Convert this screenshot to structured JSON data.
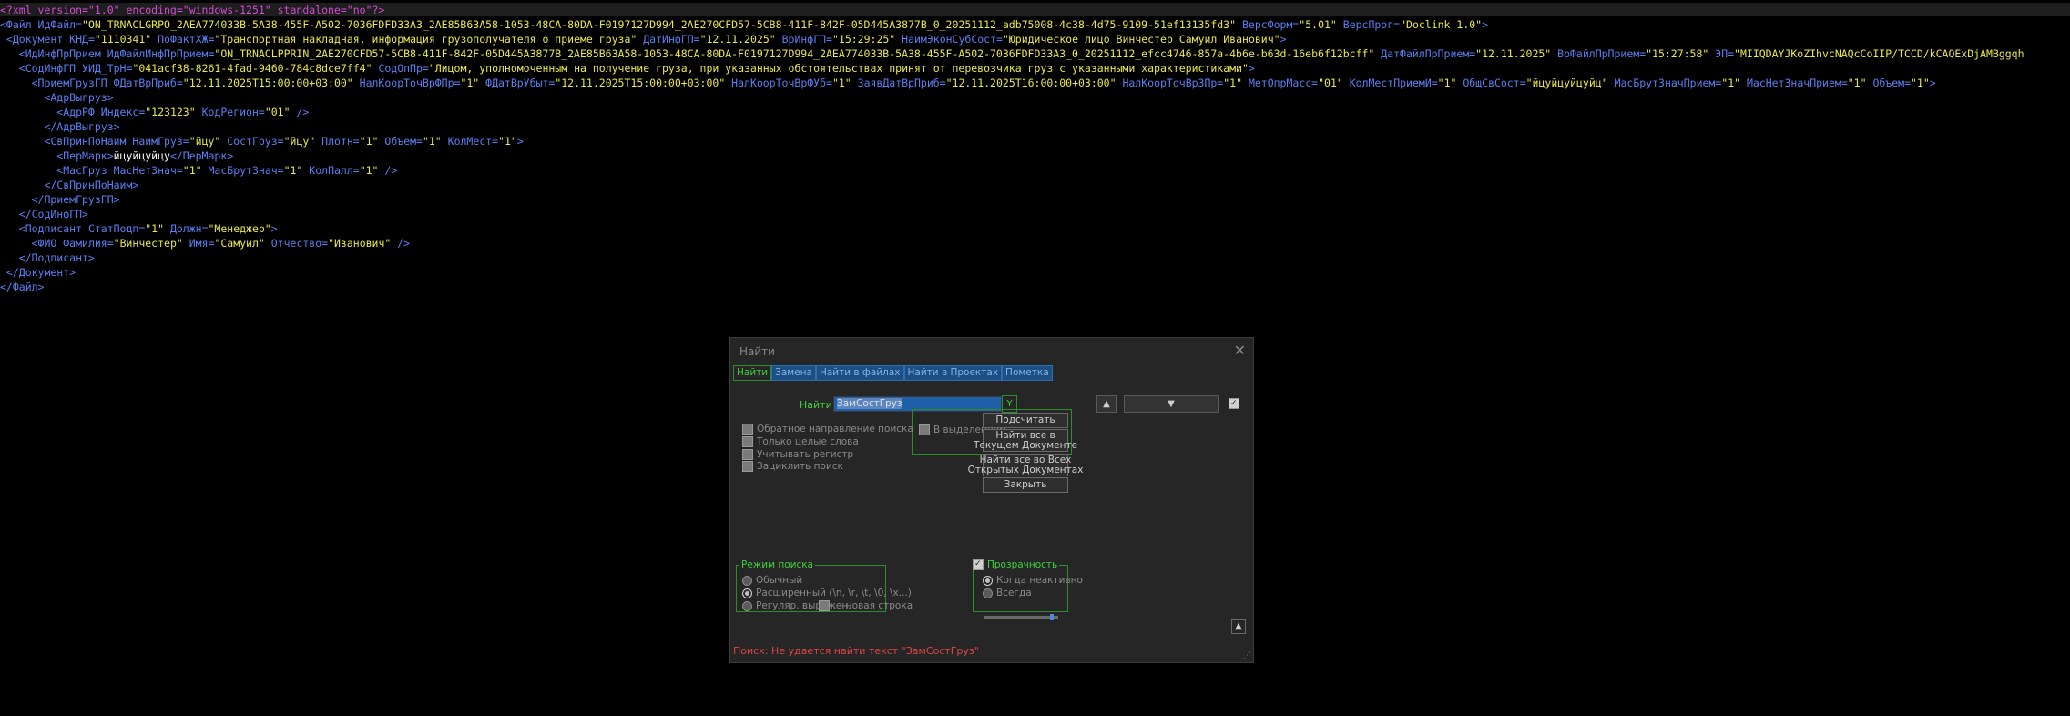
{
  "editor": {
    "lines": [
      [
        [
          "pi",
          "<?xml version=\"1.0\" encoding=\"windows-1251\" standalone=\"no\"?>"
        ]
      ],
      [
        [
          "tag",
          "<Файл "
        ],
        [
          "a",
          "ИдФайл="
        ],
        [
          "v",
          "\"ON_TRNACLGRPO_2AEA774033B-5A38-455F-A502-7036FDFD33A3_2AE85B63A58-1053-48CA-80DA-F0197127D994_2AE270CFD57-5CB8-411F-842F-05D445A3877B_0_20251112_adb75008-4c38-4d75-9109-51ef13135fd3\""
        ],
        [
          "a",
          " ВерсФорм="
        ],
        [
          "v",
          "\"5.01\""
        ],
        [
          "a",
          " ВерсПрог="
        ],
        [
          "v",
          "\"Doclink 1.0\""
        ],
        [
          "tag",
          ">"
        ]
      ],
      [
        [
          "tag",
          " <Документ "
        ],
        [
          "a",
          "КНД="
        ],
        [
          "v",
          "\"1110341\""
        ],
        [
          "a",
          " ПоФактХЖ="
        ],
        [
          "v",
          "\"Транспортная накладная, информация грузополучателя о приеме груза\""
        ],
        [
          "a",
          " ДатИнфГП="
        ],
        [
          "v",
          "\"12.11.2025\""
        ],
        [
          "a",
          " ВрИнфГП="
        ],
        [
          "v",
          "\"15:29:25\""
        ],
        [
          "a",
          " НаимЭконСубСост="
        ],
        [
          "v",
          "\"Юридическое лицо Винчестер Самуил Иванович\""
        ],
        [
          "tag",
          ">"
        ]
      ],
      [
        [
          "tag",
          "   <ИдИнфПрПрием "
        ],
        [
          "a",
          "ИдФайлИнфПрПрием="
        ],
        [
          "v",
          "\"ON_TRNACLPPRIN_2AE270CFD57-5CB8-411F-842F-05D445A3877B_2AE85B63A58-1053-48CA-80DA-F0197127D994_2AEA774033B-5A38-455F-A502-7036FDFD33A3_0_20251112_efcc4746-857a-4b6e-b63d-16eb6f12bcff\""
        ],
        [
          "a",
          " ДатФайлПрПрием="
        ],
        [
          "v",
          "\"12.11.2025\""
        ],
        [
          "a",
          " ВрФайлПрПрием="
        ],
        [
          "v",
          "\"15:27:58\""
        ],
        [
          "a",
          " ЭП="
        ],
        [
          "v",
          "\"MIIQDAYJKoZIhvcNAQcCoIIP/TCCD/kCAQExDjAMBggqh"
        ]
      ],
      [
        [
          "tag",
          "   <СодИнфГП "
        ],
        [
          "a",
          "УИД_ТрН="
        ],
        [
          "v",
          "\"041acf38-8261-4fad-9460-784c8dce7ff4\""
        ],
        [
          "a",
          " СодОпПр="
        ],
        [
          "v",
          "\"Лицом, уполномоченным на получение груза, при указанных обстоятельствах принят от перевозчика груз с указанными характеристиками\""
        ],
        [
          "tag",
          ">"
        ]
      ],
      [
        [
          "tag",
          "     <ПриемГрузГП "
        ],
        [
          "a",
          "ФДатВрПриб="
        ],
        [
          "v",
          "\"12.11.2025T15:00:00+03:00\""
        ],
        [
          "a",
          " НалКоорТочВрФПр="
        ],
        [
          "v",
          "\"1\""
        ],
        [
          "a",
          " ФДатВрУбыт="
        ],
        [
          "v",
          "\"12.11.2025T15:00:00+03:00\""
        ],
        [
          "a",
          " НалКоорТочВрФУб="
        ],
        [
          "v",
          "\"1\""
        ],
        [
          "a",
          " ЗаявДатВрПриб="
        ],
        [
          "v",
          "\"12.11.2025T16:00:00+03:00\""
        ],
        [
          "a",
          " НалКоорТочВрЗПр="
        ],
        [
          "v",
          "\"1\""
        ],
        [
          "a",
          " МетОпрМасс="
        ],
        [
          "v",
          "\"01\""
        ],
        [
          "a",
          " КолМестПриемИ="
        ],
        [
          "v",
          "\"1\""
        ],
        [
          "a",
          " ОбщСвСост="
        ],
        [
          "v",
          "\"йцуйцуйцуйц\""
        ],
        [
          "a",
          " МасБрутЗначПрием="
        ],
        [
          "v",
          "\"1\""
        ],
        [
          "a",
          " МасНетЗначПрием="
        ],
        [
          "v",
          "\"1\""
        ],
        [
          "a",
          " Объем="
        ],
        [
          "v",
          "\"1\""
        ],
        [
          "tag",
          ">"
        ]
      ],
      [
        [
          "tag",
          "       <АдрВыгруз>"
        ]
      ],
      [
        [
          "tag",
          "         <АдрРФ "
        ],
        [
          "a",
          "Индекс="
        ],
        [
          "v",
          "\"123123\""
        ],
        [
          "a",
          " КодРегион="
        ],
        [
          "v",
          "\"01\""
        ],
        [
          "tag",
          " />"
        ]
      ],
      [
        [
          "tag",
          "       </АдрВыгруз>"
        ]
      ],
      [
        [
          "tag",
          "       <СвПринПоНаим "
        ],
        [
          "a",
          "НаимГруз="
        ],
        [
          "v",
          "\"йцу\""
        ],
        [
          "a",
          " СостГруз="
        ],
        [
          "v",
          "\"йцу\""
        ],
        [
          "a",
          " Плотн="
        ],
        [
          "v",
          "\"1\""
        ],
        [
          "a",
          " Объем="
        ],
        [
          "v",
          "\"1\""
        ],
        [
          "a",
          " КолМест="
        ],
        [
          "v",
          "\"1\""
        ],
        [
          "tag",
          ">"
        ]
      ],
      [
        [
          "tag",
          "         <ПерМарк>"
        ],
        [
          "x",
          "йцуйцуйцу"
        ],
        [
          "tag",
          "</ПерМарк>"
        ]
      ],
      [
        [
          "tag",
          "         <МасГруз "
        ],
        [
          "a",
          "МасНетЗнач="
        ],
        [
          "v",
          "\"1\""
        ],
        [
          "a",
          " МасБрутЗнач="
        ],
        [
          "v",
          "\"1\""
        ],
        [
          "a",
          " КолПалл="
        ],
        [
          "v",
          "\"1\""
        ],
        [
          "tag",
          " />"
        ]
      ],
      [
        [
          "tag",
          "       </СвПринПоНаим>"
        ]
      ],
      [
        [
          "tag",
          "     </ПриемГрузГП>"
        ]
      ],
      [
        [
          "tag",
          "   </СодИнфГП>"
        ]
      ],
      [
        [
          "tag",
          "   <Подписант "
        ],
        [
          "a",
          "СтатПодп="
        ],
        [
          "v",
          "\"1\""
        ],
        [
          "a",
          " Должн="
        ],
        [
          "v",
          "\"Менеджер\""
        ],
        [
          "tag",
          ">"
        ]
      ],
      [
        [
          "tag",
          "     <ФИО "
        ],
        [
          "a",
          "Фамилия="
        ],
        [
          "v",
          "\"Винчестер\""
        ],
        [
          "a",
          " Имя="
        ],
        [
          "v",
          "\"Самуил\""
        ],
        [
          "a",
          " Отчество="
        ],
        [
          "v",
          "\"Иванович\""
        ],
        [
          "tag",
          " />"
        ]
      ],
      [
        [
          "tag",
          "   </Подписант>"
        ]
      ],
      [
        [
          "tag",
          " </Документ>"
        ]
      ],
      [
        [
          "tag",
          "</Файл>"
        ]
      ]
    ]
  },
  "dialog": {
    "title": "Найти",
    "tabs": [
      "Найти",
      "Замена",
      "Найти в файлах",
      "Найти в Проектах",
      "Пометка"
    ],
    "find_label": "Найти:",
    "find_value": "ЗамСостГруз",
    "dropdown_mark": "Y",
    "up_arrow": "▲",
    "down_arrow": "▼",
    "in_selection": "В выделенном",
    "btn_count": "Подсчитать",
    "btn_find_all_current": "Найти все в\nТекущем Документе",
    "btn_find_all_open": "Найти все во Всех\nОткрытых Документах",
    "btn_close": "Закрыть",
    "options": [
      "Обратное направление поиска",
      "Только целые слова",
      "Учитывать регистр",
      "Зациклить поиск"
    ],
    "mode_title": "Режим поиска",
    "modes": [
      "Обычный",
      "Расширенный (\\n, \\r, \\t, \\0, \\x...)",
      "Регуляр. выражен."
    ],
    "newline_label": ". - новая строка",
    "transparency_title": "Прозрачность",
    "transparency_opts": [
      "Когда неактивно",
      "Всегда"
    ],
    "transparency_level": 0.94,
    "status": "Поиск: Не удается найти текст \"ЗамСостГруз\"",
    "close_icon": "close-icon",
    "resize_icon": "resize-grip-icon"
  }
}
